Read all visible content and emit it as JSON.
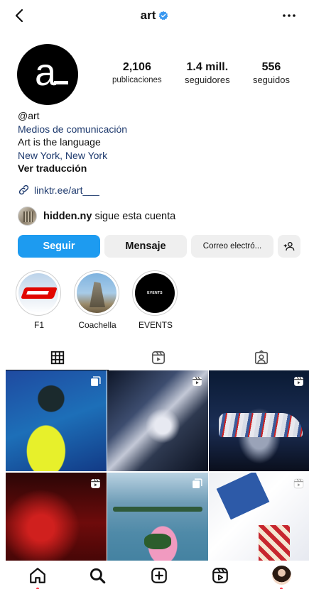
{
  "header": {
    "username": "art",
    "back_icon": "chevron-left-icon",
    "verified_icon": "verified-badge-icon",
    "more_icon": "more-horizontal-icon",
    "accent_color": "#3897f0"
  },
  "profile": {
    "avatar_letter": "a",
    "stats": [
      {
        "value": "2,106",
        "label": "publicaciones"
      },
      {
        "value": "1.4 mill.",
        "label": "seguidores"
      },
      {
        "value": "556",
        "label": "seguidos"
      }
    ],
    "handle": "@art",
    "category": "Medios de comunicación",
    "bio": "Art is the language",
    "location": "New York, New York",
    "translate_label": "Ver traducción",
    "link_text": "linktr.ee/art___",
    "followed_by": {
      "name": "hidden.ny",
      "text": "sigue esta cuenta"
    }
  },
  "actions": {
    "follow_label": "Seguir",
    "message_label": "Mensaje",
    "email_label": "Correo electró...",
    "add_user_icon": "add-user-icon",
    "follow_color": "#1d9bf0"
  },
  "highlights": [
    {
      "label": "F1"
    },
    {
      "label": "Coachella"
    },
    {
      "label": "EVENTS",
      "cover_text": "EVENTS"
    }
  ],
  "tabs": [
    {
      "icon": "grid-icon",
      "active": true
    },
    {
      "icon": "reels-icon",
      "active": false
    },
    {
      "icon": "tagged-icon",
      "active": false
    }
  ],
  "posts": [
    {
      "badge": "carousel-icon"
    },
    {
      "badge": "reel-icon"
    },
    {
      "badge": "reel-icon"
    },
    {
      "badge": "reel-icon"
    },
    {
      "badge": "carousel-icon"
    },
    {
      "badge": "reel-icon"
    }
  ],
  "bottom_nav": [
    {
      "icon": "home-icon"
    },
    {
      "icon": "search-icon"
    },
    {
      "icon": "create-icon"
    },
    {
      "icon": "reels-icon"
    },
    {
      "icon": "profile-avatar"
    }
  ]
}
